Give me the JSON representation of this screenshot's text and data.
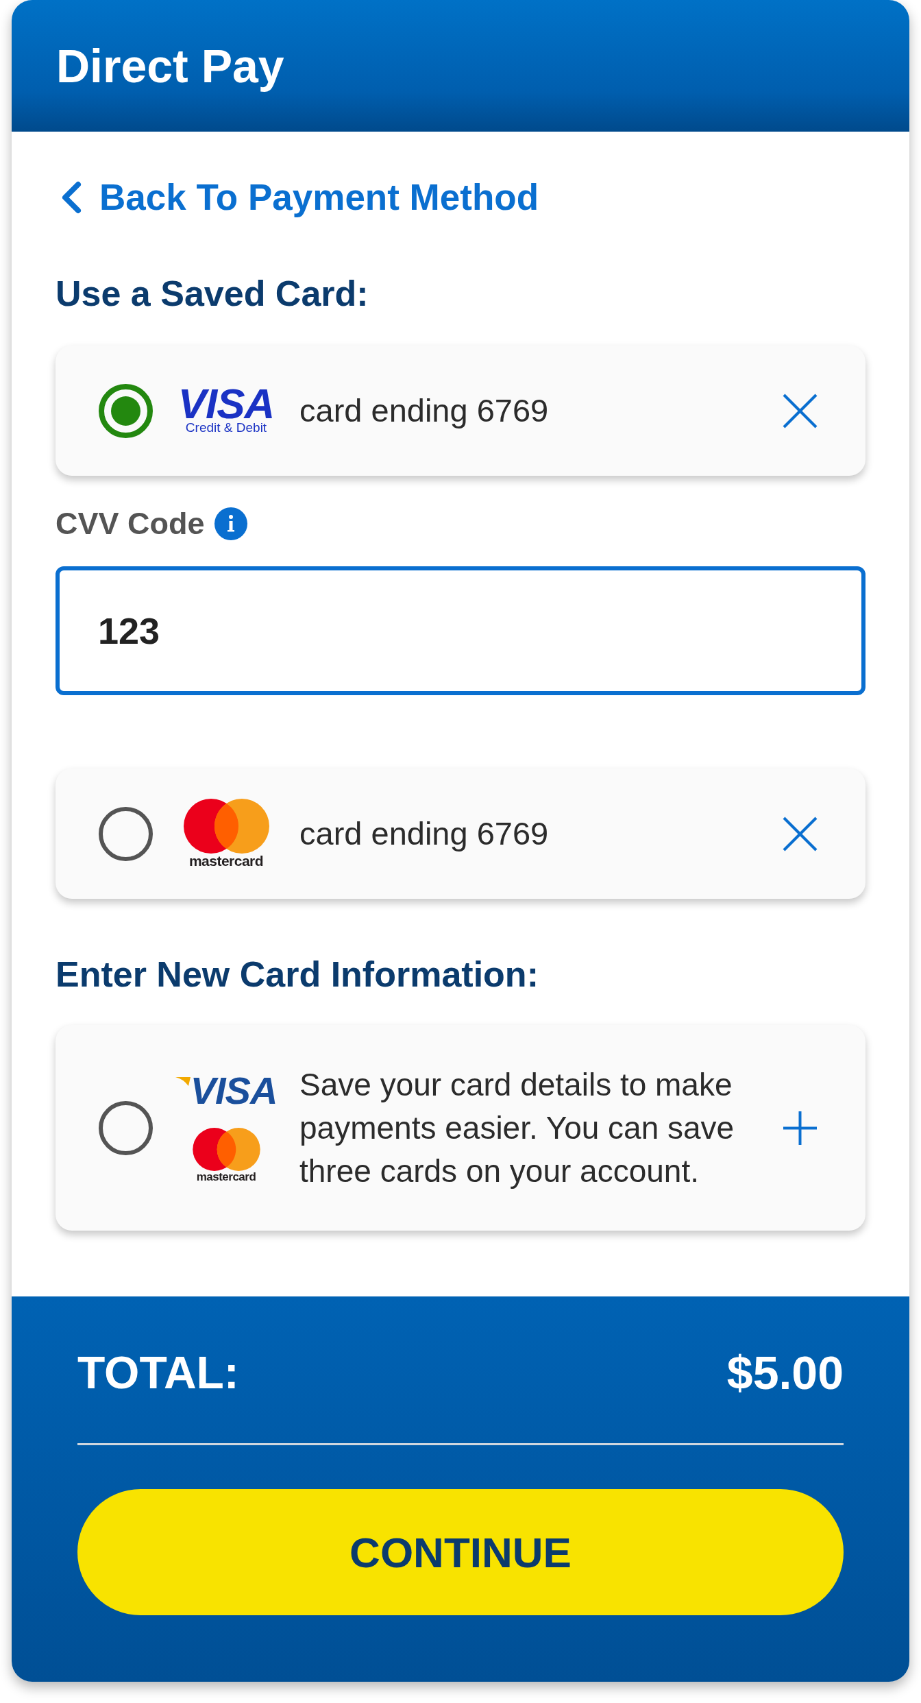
{
  "header": {
    "title": "Direct Pay"
  },
  "back_link": {
    "label": "Back To Payment Method"
  },
  "saved_cards": {
    "heading": "Use a Saved Card:",
    "cards": [
      {
        "selected": true,
        "logo": {
          "kind": "visa",
          "wordmark": "VISA",
          "tagline": "Credit & Debit"
        },
        "label": "card ending 6769",
        "cvv": {
          "label": "CVV Code",
          "value": "123"
        }
      },
      {
        "selected": false,
        "logo": {
          "kind": "mastercard",
          "wordmark": "mastercard"
        },
        "label": "card ending 6769"
      }
    ]
  },
  "new_card": {
    "heading": "Enter New Card Information:",
    "selected": false,
    "logos": [
      {
        "kind": "visa-classic",
        "wordmark": "VISA"
      },
      {
        "kind": "mastercard",
        "wordmark": "mastercard"
      }
    ],
    "text": "Save your card details to make payments easier. You can save three cards on your account."
  },
  "footer": {
    "total_label": "TOTAL:",
    "total_value": "$5.00",
    "button": "CONTINUE"
  }
}
